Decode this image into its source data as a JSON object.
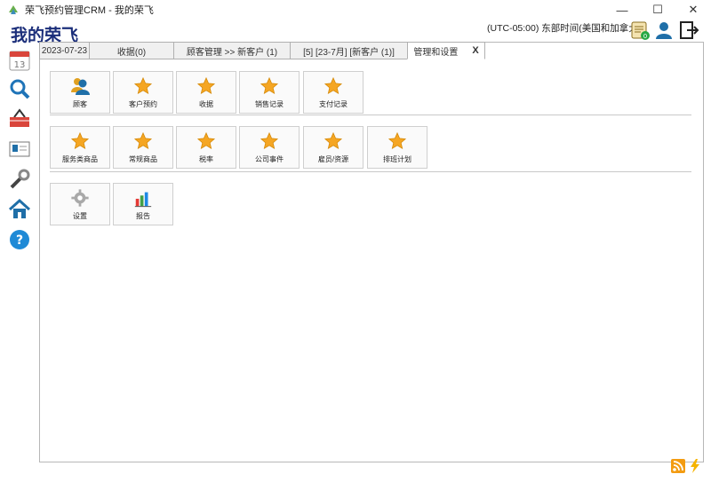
{
  "window": {
    "title": "荣飞预约管理CRM - 我的荣飞",
    "minimize_symbol": "—",
    "maximize_symbol": "☐",
    "close_symbol": "✕"
  },
  "header": {
    "brand": "我的荣飞",
    "timezone": "(UTC-05:00) 东部时间(美国和加拿大)",
    "icons": [
      "calendar-badge-icon",
      "user-icon",
      "logout-icon"
    ]
  },
  "leftrail": [
    "calendar-icon",
    "search-icon",
    "basket-icon",
    "contact-card-icon",
    "wrench-icon",
    "home-icon",
    "help-icon"
  ],
  "calendar_day": "13",
  "tabs": [
    {
      "label": "2023-07-23",
      "active": false
    },
    {
      "label": "收据(0)",
      "active": false
    },
    {
      "label": "顾客管理 >> 新客户 (1)",
      "active": false
    },
    {
      "label": "[5] [23-7月] [新客户 (1)]",
      "active": false
    },
    {
      "label": "管理和设置",
      "active": true,
      "close": "X"
    }
  ],
  "groups": {
    "row1": [
      {
        "label": "顾客",
        "icon": "customer-icon"
      },
      {
        "label": "客户预约",
        "icon": "star-icon"
      },
      {
        "label": "收据",
        "icon": "star-icon"
      },
      {
        "label": "销售记录",
        "icon": "star-icon"
      },
      {
        "label": "支付记录",
        "icon": "star-icon"
      }
    ],
    "row2": [
      {
        "label": "服务类商品",
        "icon": "star-icon"
      },
      {
        "label": "常规商品",
        "icon": "star-icon"
      },
      {
        "label": "税率",
        "icon": "star-icon"
      },
      {
        "label": "公司事件",
        "icon": "star-icon"
      },
      {
        "label": "雇员/资源",
        "icon": "star-icon"
      },
      {
        "label": "排班计划",
        "icon": "star-icon"
      }
    ],
    "row3": [
      {
        "label": "设置",
        "icon": "gear-icon"
      },
      {
        "label": "报告",
        "icon": "bar-chart-icon"
      }
    ]
  },
  "status_icons": [
    "rss-icon",
    "lightning-icon"
  ]
}
